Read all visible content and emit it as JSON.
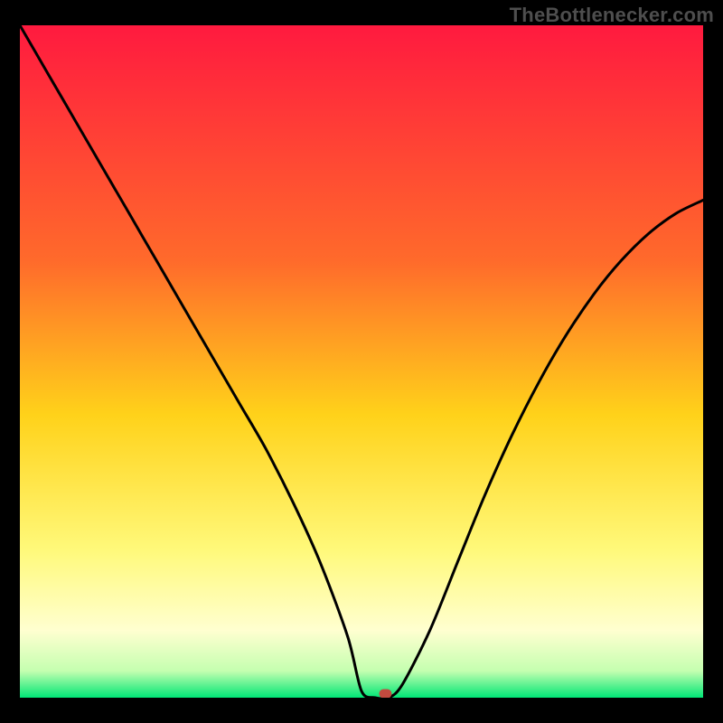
{
  "watermark": "TheBottlenecker.com",
  "chart_data": {
    "type": "line",
    "title": "",
    "xlabel": "",
    "ylabel": "",
    "xlim": [
      0,
      100
    ],
    "ylim": [
      0,
      100
    ],
    "gradient_stops": [
      {
        "offset": 0,
        "color": "#ff1a3f"
      },
      {
        "offset": 35,
        "color": "#ff6a2b"
      },
      {
        "offset": 58,
        "color": "#ffd21a"
      },
      {
        "offset": 78,
        "color": "#fff97a"
      },
      {
        "offset": 90,
        "color": "#ffffd0"
      },
      {
        "offset": 96,
        "color": "#c5ffb0"
      },
      {
        "offset": 100,
        "color": "#00e676"
      }
    ],
    "series": [
      {
        "name": "bottleneck-curve",
        "x": [
          0,
          4,
          8,
          12,
          16,
          20,
          24,
          28,
          32,
          36,
          40,
          44,
          48,
          50,
          52,
          54,
          56,
          60,
          64,
          68,
          72,
          76,
          80,
          84,
          88,
          92,
          96,
          100
        ],
        "y": [
          100,
          93,
          86,
          79,
          72,
          65,
          58,
          51,
          44,
          37,
          29,
          20,
          9,
          1,
          0,
          0,
          2,
          10,
          20,
          30,
          39,
          47,
          54,
          60,
          65,
          69,
          72,
          74
        ]
      }
    ],
    "marker": {
      "x": 53.5,
      "y": 0.6,
      "color": "#c24a3f"
    },
    "baseline_y": 0
  }
}
